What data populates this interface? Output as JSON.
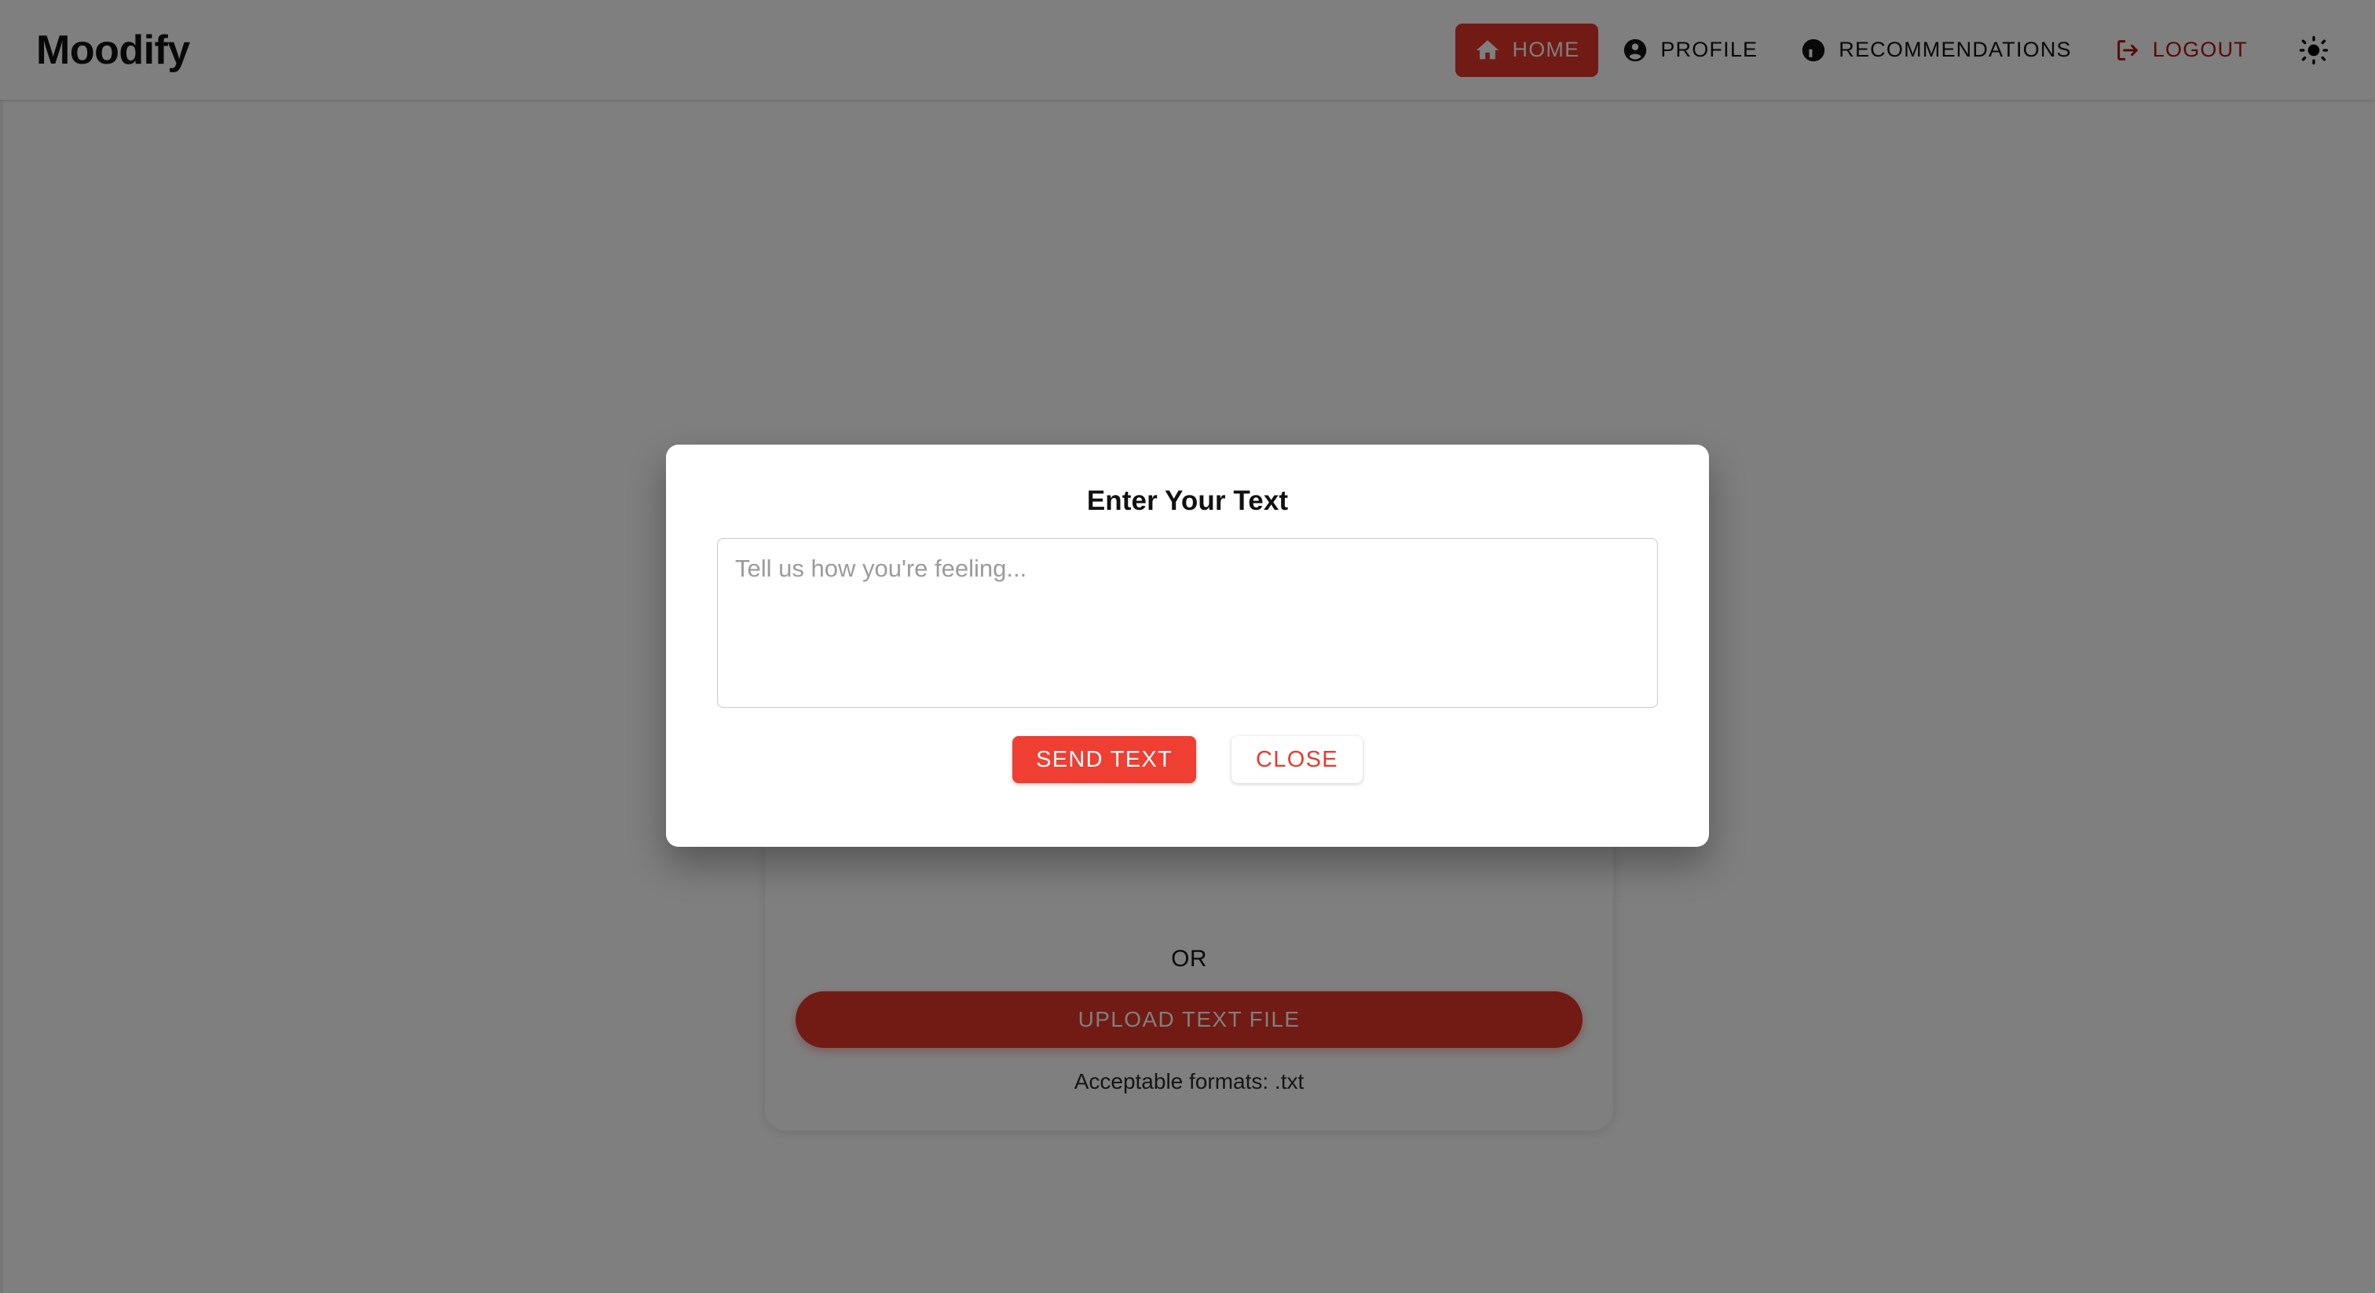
{
  "header": {
    "brand": "Moodify",
    "nav": [
      {
        "id": "home",
        "label": "HOME",
        "icon": "home-icon",
        "active": true
      },
      {
        "id": "profile",
        "label": "PROFILE",
        "icon": "account-circle-icon",
        "active": false
      },
      {
        "id": "recommendations",
        "label": "RECOMMENDATIONS",
        "icon": "thumb-up-icon",
        "active": false
      },
      {
        "id": "logout",
        "label": "LOGOUT",
        "icon": "logout-icon",
        "active": false
      }
    ],
    "theme_toggle_icon": "sun-icon"
  },
  "main": {
    "divider_label": "OR",
    "upload_button_label": "UPLOAD TEXT FILE",
    "formats_note": "Acceptable formats: .txt"
  },
  "modal": {
    "title": "Enter Your Text",
    "textarea_placeholder": "Tell us how you're feeling...",
    "textarea_value": "",
    "primary_button_label": "SEND TEXT",
    "secondary_button_label": "CLOSE"
  },
  "colors": {
    "accent_red": "#e53428",
    "button_red": "#ef3e32",
    "logout_red": "#b3150c",
    "backdrop": "rgba(0,0,0,0.5)",
    "text_dark": "#111111"
  }
}
